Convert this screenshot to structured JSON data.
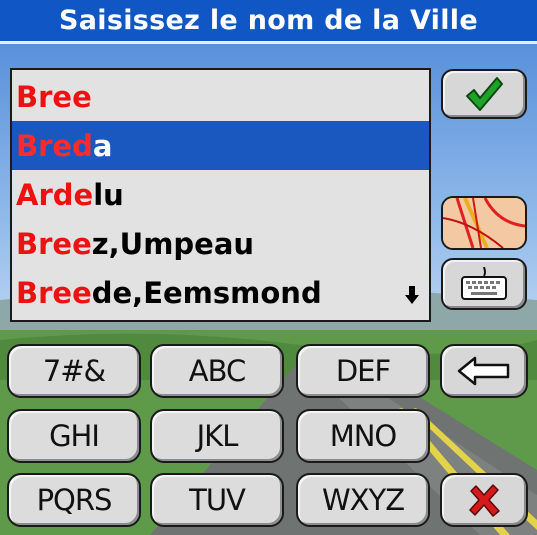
{
  "title": "Saisissez le nom de la Ville",
  "results": [
    {
      "match": "Bree",
      "rest": "",
      "selected": false
    },
    {
      "match": "Bred",
      "rest": "a",
      "selected": true
    },
    {
      "match": "Arde",
      "rest": "lu",
      "selected": false
    },
    {
      "match": "Bree",
      "rest": "z,Umpeau",
      "selected": false
    },
    {
      "match": "Bree",
      "rest": "de,Eemsmond",
      "selected": false
    }
  ],
  "keypad": {
    "row1": [
      "7#&",
      "ABC",
      "DEF"
    ],
    "row2": [
      "GHI",
      "JKL",
      "MNO"
    ],
    "row3": [
      "PQRS",
      "TUV",
      "WXYZ"
    ]
  },
  "icons": {
    "confirm": "checkmark-icon",
    "map": "map-icon",
    "keyboard": "keyboard-icon",
    "backspace": "backspace-arrow-icon",
    "cancel": "cancel-x-icon",
    "scroll": "scroll-down-arrow-icon"
  },
  "colors": {
    "title_bar": "#1056c4",
    "selection": "#1a58c0",
    "match_text": "#ee1111",
    "confirm": "#1fa22a",
    "cancel": "#d41a1a"
  }
}
